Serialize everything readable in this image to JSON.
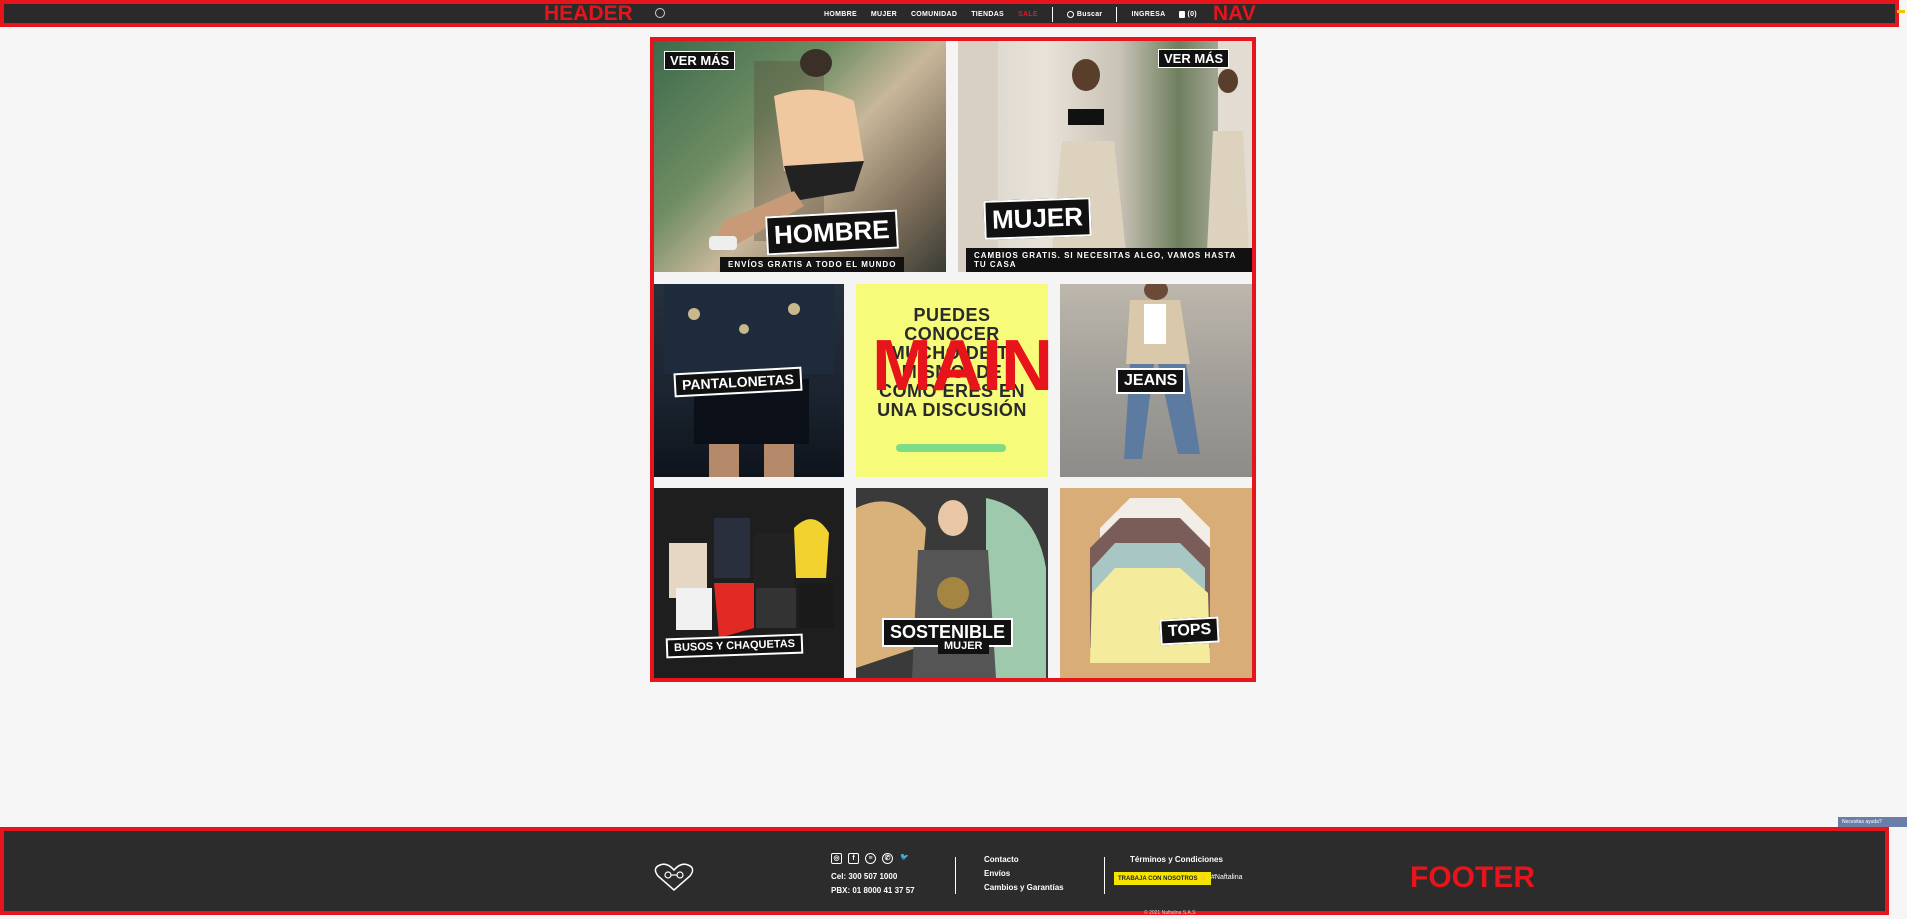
{
  "labels": {
    "header": "HEADER",
    "nav": "NAV",
    "main": "MAIN",
    "footer": "FOOTER"
  },
  "nav": {
    "items": [
      "HOMBRE",
      "MUJER",
      "COMUNIDAD",
      "TIENDAS",
      "SALE"
    ],
    "search_label": "Buscar",
    "login_label": "INGRESA",
    "cart_label": "(0)"
  },
  "tiles": {
    "hombre": {
      "title": "HOMBRE",
      "more": "VER MÁS",
      "strip": "ENVÍOS GRATIS A TODO EL MUNDO"
    },
    "mujer": {
      "title": "MUJER",
      "more": "VER MÁS",
      "strip": "CAMBIOS GRATIS. SI NECESITAS ALGO, VAMOS HASTA TU CASA"
    },
    "pantalonetas": {
      "title": "PANTALONETAS"
    },
    "quote": {
      "text": "PUEDES CONOCER MUCHO DE TI MISMO. DE COMO ERES EN UNA DISCUSIÓN"
    },
    "jeans": {
      "title": "JEANS"
    },
    "busos": {
      "title": "BUSOS Y CHAQUETAS"
    },
    "sostenible": {
      "title": "SOSTENIBLE",
      "subtitle": "MUJER"
    },
    "tops": {
      "title": "TOPS"
    }
  },
  "chat": {
    "label": "Necesitas ayuda?"
  },
  "footer": {
    "social_icons": [
      "instagram-icon",
      "facebook-icon",
      "spotify-icon",
      "whatsapp-icon",
      "twitter-icon"
    ],
    "phone_cel": "Cel: 300 507 1000",
    "phone_pbx": "PBX: 01 8000 41 37 57",
    "links": [
      "Contacto",
      "Envíos",
      "Cambios y Garantías"
    ],
    "terms": "Términos y Condiciones",
    "work_with_us": "TRABAJA CON NOSOTROS ⚡",
    "hashtag": "#Naftalina",
    "copyright": "© 2021 Naftalina S.A.S"
  },
  "colors": {
    "accent": "#e8141c",
    "header_bg": "#2a2a2a",
    "footer_bg": "#2c2c2c",
    "quote_bg": "#f7fb7a",
    "work_button": "#f5e400"
  }
}
